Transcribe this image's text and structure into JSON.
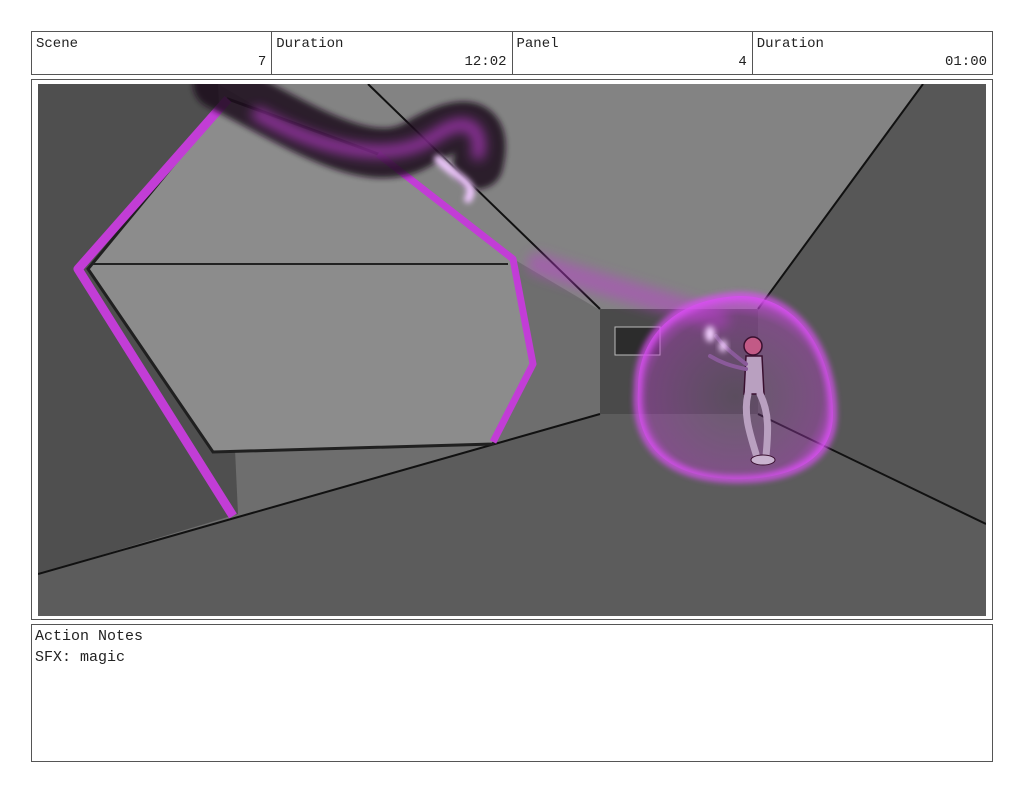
{
  "header": {
    "scene_label": "Scene",
    "scene_value": "7",
    "scene_duration_label": "Duration",
    "scene_duration_value": "12:02",
    "panel_label": "Panel",
    "panel_value": "4",
    "panel_duration_label": "Duration",
    "panel_duration_value": "01:00"
  },
  "frame": {
    "description_icons": [
      "hexagon-portal",
      "magic-shield-bubble",
      "character",
      "magic-tendril"
    ],
    "colors": {
      "floor": "#5e5e5e",
      "ceiling": "#7d7d7d",
      "magic": "#c23dd6",
      "portal_inner": "#8a8a8a"
    }
  },
  "notes": {
    "title": "Action Notes",
    "text": "SFX: magic"
  }
}
